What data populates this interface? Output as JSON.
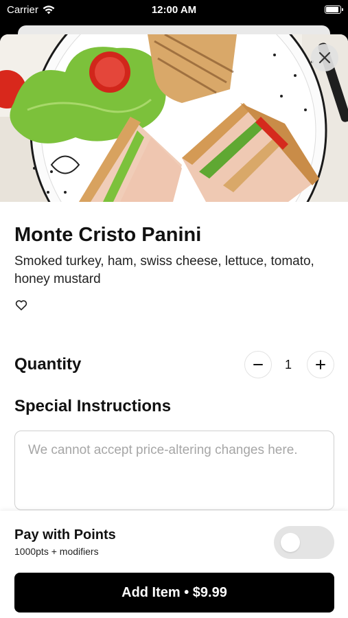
{
  "status_bar": {
    "carrier": "Carrier",
    "time": "12:00 AM"
  },
  "item": {
    "name": "Monte Cristo Panini",
    "description": "Smoked turkey, ham, swiss cheese, lettuce, tomato, honey mustard"
  },
  "quantity": {
    "label": "Quantity",
    "value": "1",
    "decrement_icon": "minus-icon",
    "increment_icon": "plus-icon"
  },
  "special_instructions": {
    "label": "Special Instructions",
    "placeholder": "We cannot accept price-altering changes here."
  },
  "points": {
    "label": "Pay with Points",
    "subtext": "1000pts + modifiers",
    "enabled": false
  },
  "add_button": {
    "label": "Add Item • $9.99"
  },
  "icons": {
    "close": "close-icon",
    "favorite": "heart-icon",
    "wifi": "wifi-icon",
    "battery": "battery-icon"
  }
}
